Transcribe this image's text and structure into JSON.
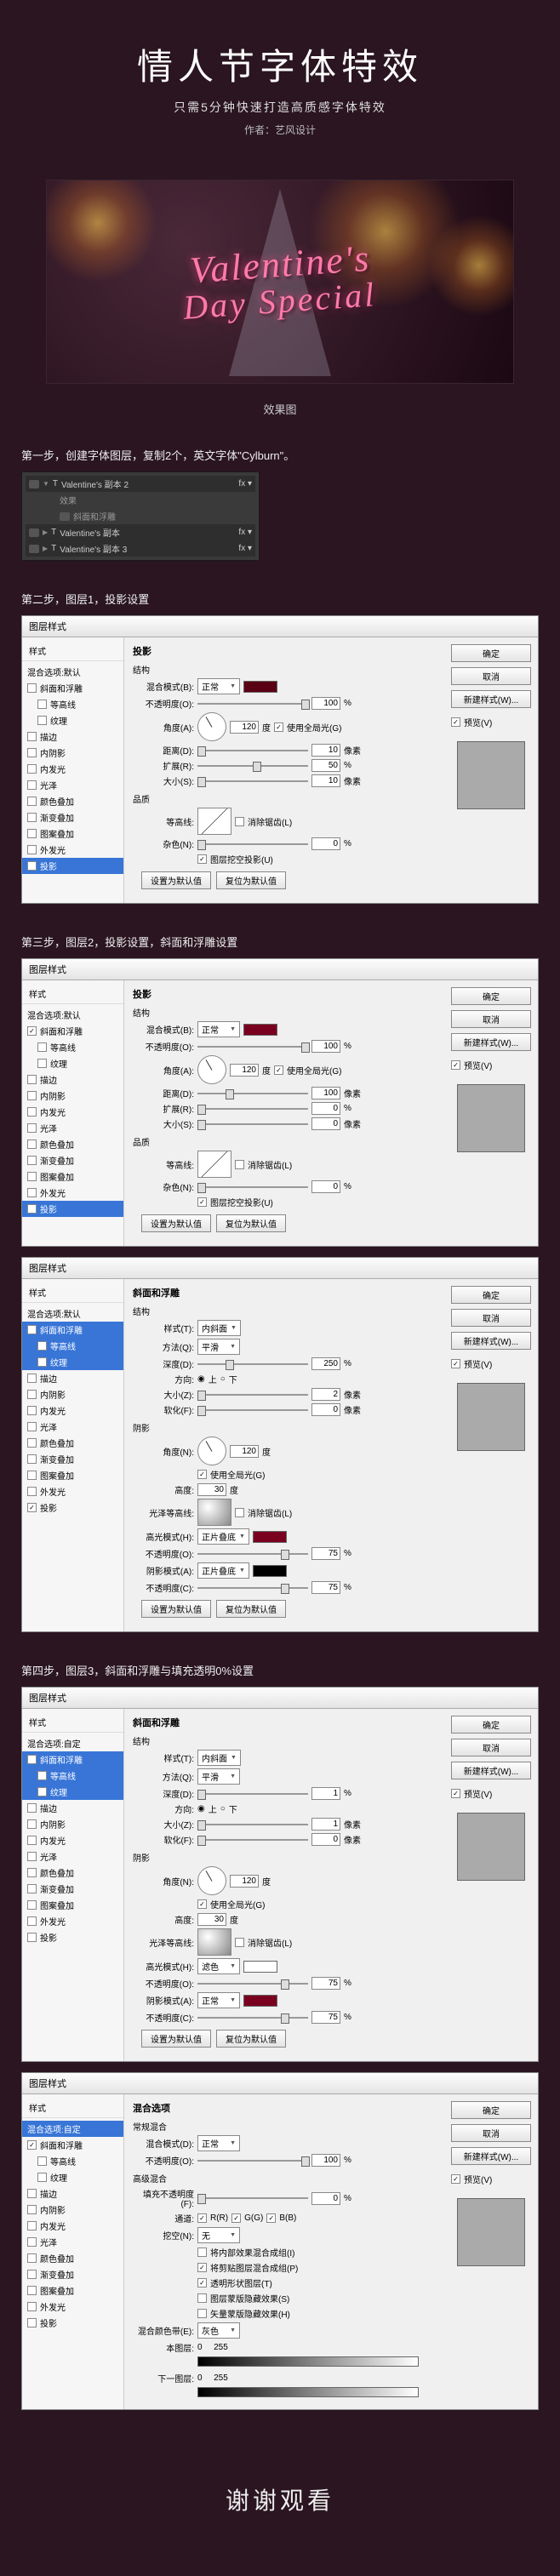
{
  "header": {
    "title": "情人节字体特效",
    "subtitle": "只需5分钟快速打造高质感字体特效",
    "author": "作者：艺风设计"
  },
  "hero": {
    "line1": "Valentine's",
    "line2": "Day Special",
    "caption": "效果图"
  },
  "step1": {
    "title": "第一步，创建字体图层，复制2个，英文字体\"Cylburn\"。",
    "layers": {
      "top": "Valentine's 副本 2",
      "fx": "效果",
      "fxItem": "斜面和浮雕",
      "mid": "Valentine's 副本",
      "bottom": "Valentine's 副本 3"
    }
  },
  "step2": {
    "title": "第二步，图层1，投影设置"
  },
  "step3": {
    "title": "第三步，图层2，投影设置，斜面和浮雕设置"
  },
  "step4": {
    "title": "第四步，图层3，斜面和浮雕与填充透明0%设置"
  },
  "dialog": {
    "title": "图层样式",
    "leftHead": "样式",
    "styles": {
      "blendDefault": "混合选项:默认",
      "blendCustom": "混合选项:自定",
      "bevel": "斜面和浮雕",
      "contour": "等高线",
      "texture": "纹理",
      "stroke": "描边",
      "innerShadow": "内阴影",
      "innerGlow": "内发光",
      "satin": "光泽",
      "colorOverlay": "颜色叠加",
      "gradientOverlay": "渐变叠加",
      "patternOverlay": "图案叠加",
      "outerGlow": "外发光",
      "dropShadow": "投影"
    },
    "buttons": {
      "ok": "确定",
      "cancel": "取消",
      "newStyle": "新建样式(W)...",
      "preview": "预览(V)",
      "default1": "设置为默认值",
      "default2": "复位为默认值"
    },
    "shadow": {
      "header": "投影",
      "struct": "结构",
      "blendMode": "混合模式(B):",
      "blendVal": "正常",
      "opacity": "不透明度(O):",
      "opacityVal": "100",
      "pct": "%",
      "angle": "角度(A):",
      "angleVal": "120",
      "deg": "度",
      "global": "使用全局光(G)",
      "distance": "距离(D):",
      "distanceVal": "10",
      "px": "像素",
      "spread": "扩展(R):",
      "spreadVal": "50",
      "size": "大小(S):",
      "sizeVal": "10",
      "quality": "品质",
      "contour": "等高线:",
      "anti": "消除锯齿(L)",
      "noise": "杂色(N):",
      "noiseVal": "0",
      "knockout": "图层挖空投影(U)"
    },
    "shadow2": {
      "distanceVal": "100",
      "spreadVal": "0",
      "sizeVal": "0"
    },
    "bevel": {
      "header": "斜面和浮雕",
      "struct": "结构",
      "style": "样式(T):",
      "styleVal": "内斜面",
      "tech": "方法(Q):",
      "techVal": "平滑",
      "depth": "深度(D):",
      "depthVal": "250",
      "dir": "方向:",
      "up": "上",
      "down": "下",
      "size": "大小(Z):",
      "sizeVal": "2",
      "soften": "软化(F):",
      "softenVal": "0",
      "shade": "阴影",
      "angle": "角度(N):",
      "angleVal": "120",
      "global": "使用全局光(G)",
      "alt": "高度:",
      "altVal": "30",
      "gloss": "光泽等高线:",
      "anti": "消除锯齿(L)",
      "hiMode": "高光模式(H):",
      "hiVal": "正片叠底",
      "hiOp": "不透明度(O):",
      "hiOpVal": "75",
      "shMode": "阴影模式(A):",
      "shVal": "正片叠底",
      "shOp": "不透明度(C):",
      "shOpVal": "75"
    },
    "bevel4": {
      "styleVal": "内斜面",
      "techVal": "平滑",
      "depthVal": "1",
      "sizeVal": "1",
      "softenVal": "0",
      "hiVal": "滤色",
      "shVal": "正常"
    },
    "blend": {
      "header": "混合选项",
      "general": "常规混合",
      "mode": "混合模式(D):",
      "modeVal": "正常",
      "opacity": "不透明度(O):",
      "opacityVal": "100",
      "adv": "高级混合",
      "fill": "填充不透明度(F):",
      "fillVal": "0",
      "channels": "通道:",
      "r": "R(R)",
      "g": "G(G)",
      "b": "B(B)",
      "knockout": "挖空(N):",
      "knockVal": "无",
      "o1": "将内部效果混合成组(I)",
      "o2": "将剪贴图层混合成组(P)",
      "o3": "透明形状图层(T)",
      "o4": "图层蒙版隐藏效果(S)",
      "o5": "矢量蒙版隐藏效果(H)",
      "blendIf": "混合颜色带(E):",
      "blendIfVal": "灰色",
      "this": "本图层:",
      "thisVal1": "0",
      "thisVal2": "255",
      "under": "下一图层:",
      "underVal1": "0",
      "underVal2": "255"
    }
  },
  "thanks": "谢谢观看"
}
